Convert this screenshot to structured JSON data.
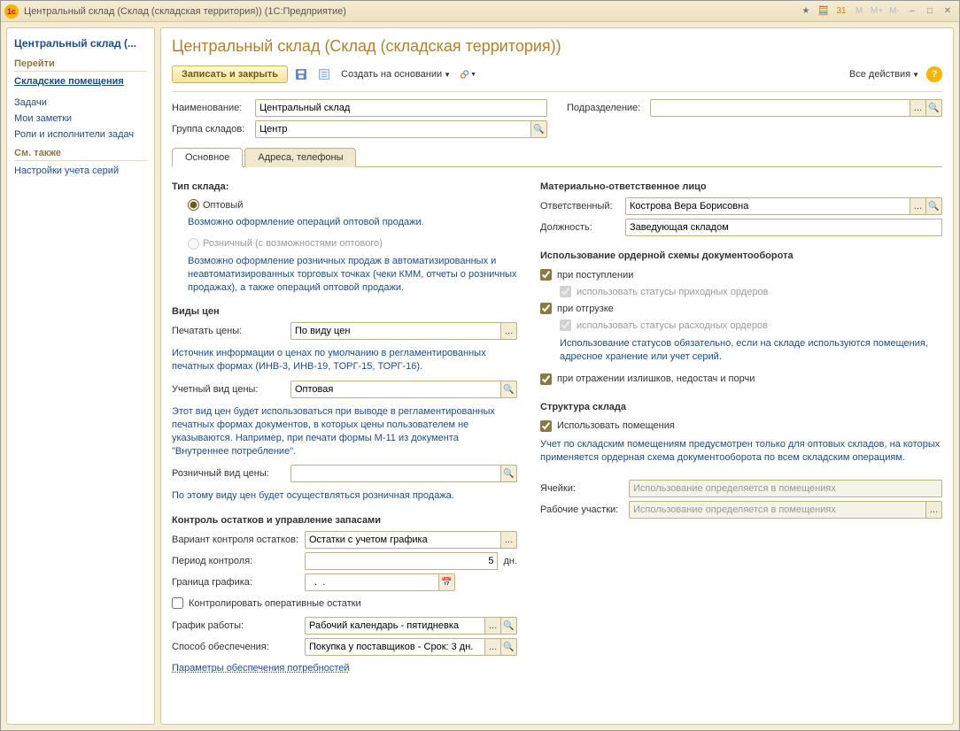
{
  "window": {
    "title": "Центральный склад (Склад (складская территория))  (1С:Предприятие)"
  },
  "sidebar": {
    "head": "Центральный склад (...",
    "sub1": "Перейти",
    "items1": [
      "Складские помещения",
      "Задачи",
      "Мои заметки",
      "Роли и исполнители задач"
    ],
    "sub2": "См. также",
    "items2": [
      "Настройки учета серий"
    ]
  },
  "page": {
    "title": "Центральный склад (Склад (складская территория))"
  },
  "toolbar": {
    "save_close": "Записать и закрыть",
    "create_based": "Создать на основании",
    "all_actions": "Все действия"
  },
  "fields": {
    "name_label": "Наименование:",
    "name_value": "Центральный склад",
    "group_label": "Группа складов:",
    "group_value": "Центр",
    "division_label": "Подразделение:",
    "division_value": ""
  },
  "tabs": {
    "main": "Основное",
    "addr": "Адреса, телефоны"
  },
  "type": {
    "title": "Тип склада:",
    "opt": "Оптовый",
    "opt_hint": "Возможно оформление операций оптовой продажи.",
    "retail": "Розничный (с возможностями оптового)",
    "retail_hint": "Возможно оформление розничных продаж в автоматизированных и неавтоматизированных торговых точках (чеки КММ, отчеты о розничных продажах), а также операций оптовой продажи."
  },
  "prices": {
    "title": "Виды цен",
    "print_label": "Печатать цены:",
    "print_value": "По виду цен",
    "print_hint": "Источник информации о ценах по умолчанию в регламентированных печатных формах (ИНВ-3, ИНВ-19, ТОРГ-15, ТОРГ-16).",
    "acct_label": "Учетный вид цены:",
    "acct_value": "Оптовая",
    "acct_hint": "Этот вид цен будет использоваться при выводе в регламентированных печатных формах документов, в которых цены пользователем не указываются. Например, при печати формы М-11 из документа \"Внутреннее потребление\".",
    "retail_label": "Розничный вид цены:",
    "retail_value": "",
    "retail_hint": "По этому виду цен будет осуществляться розничная продажа."
  },
  "stock": {
    "title": "Контроль остатков и управление запасами",
    "variant_label": "Вариант контроля остатков:",
    "variant_value": "Остатки с учетом графика",
    "period_label": "Период контроля:",
    "period_value": "5",
    "period_unit": "дн.",
    "border_label": "Граница графика:",
    "border_value": "  .  .    ",
    "chk_oper": "Контролировать оперативные остатки",
    "schedule_label": "График работы:",
    "schedule_value": "Рабочий календарь - пятидневка",
    "supply_label": "Способ обеспечения:",
    "supply_value": "Покупка у поставщиков - Срок: 3 дн.",
    "params_link": "Параметры обеспечения потребностей"
  },
  "mol": {
    "title": "Материально-ответственное лицо",
    "resp_label": "Ответственный:",
    "resp_value": "Кострова Вера Борисовна",
    "role_label": "Должность:",
    "role_value": "Заведующая складом"
  },
  "order": {
    "title": "Использование ордерной схемы документооборота",
    "c1": "при поступлении",
    "c1a": "использовать статусы приходных ордеров",
    "c2": "при отгрузке",
    "c2a": "использовать статусы расходных ордеров",
    "hint": "Использование статусов обязательно, если на складе используются помещения, адресное хранение или учет серий.",
    "c3": "при отражении излишков, недостач и порчи"
  },
  "struct": {
    "title": "Структура склада",
    "c1": "Использовать помещения",
    "hint": "Учет по складским помещениям предусмотрен только для оптовых складов, на которых применяется ордерная схема документооборота по всем складским операциям.",
    "cells_label": "Ячейки:",
    "cells_value": "Использование определяется в помещениях",
    "areas_label": "Рабочие участки:",
    "areas_value": "Использование определяется в помещениях"
  }
}
